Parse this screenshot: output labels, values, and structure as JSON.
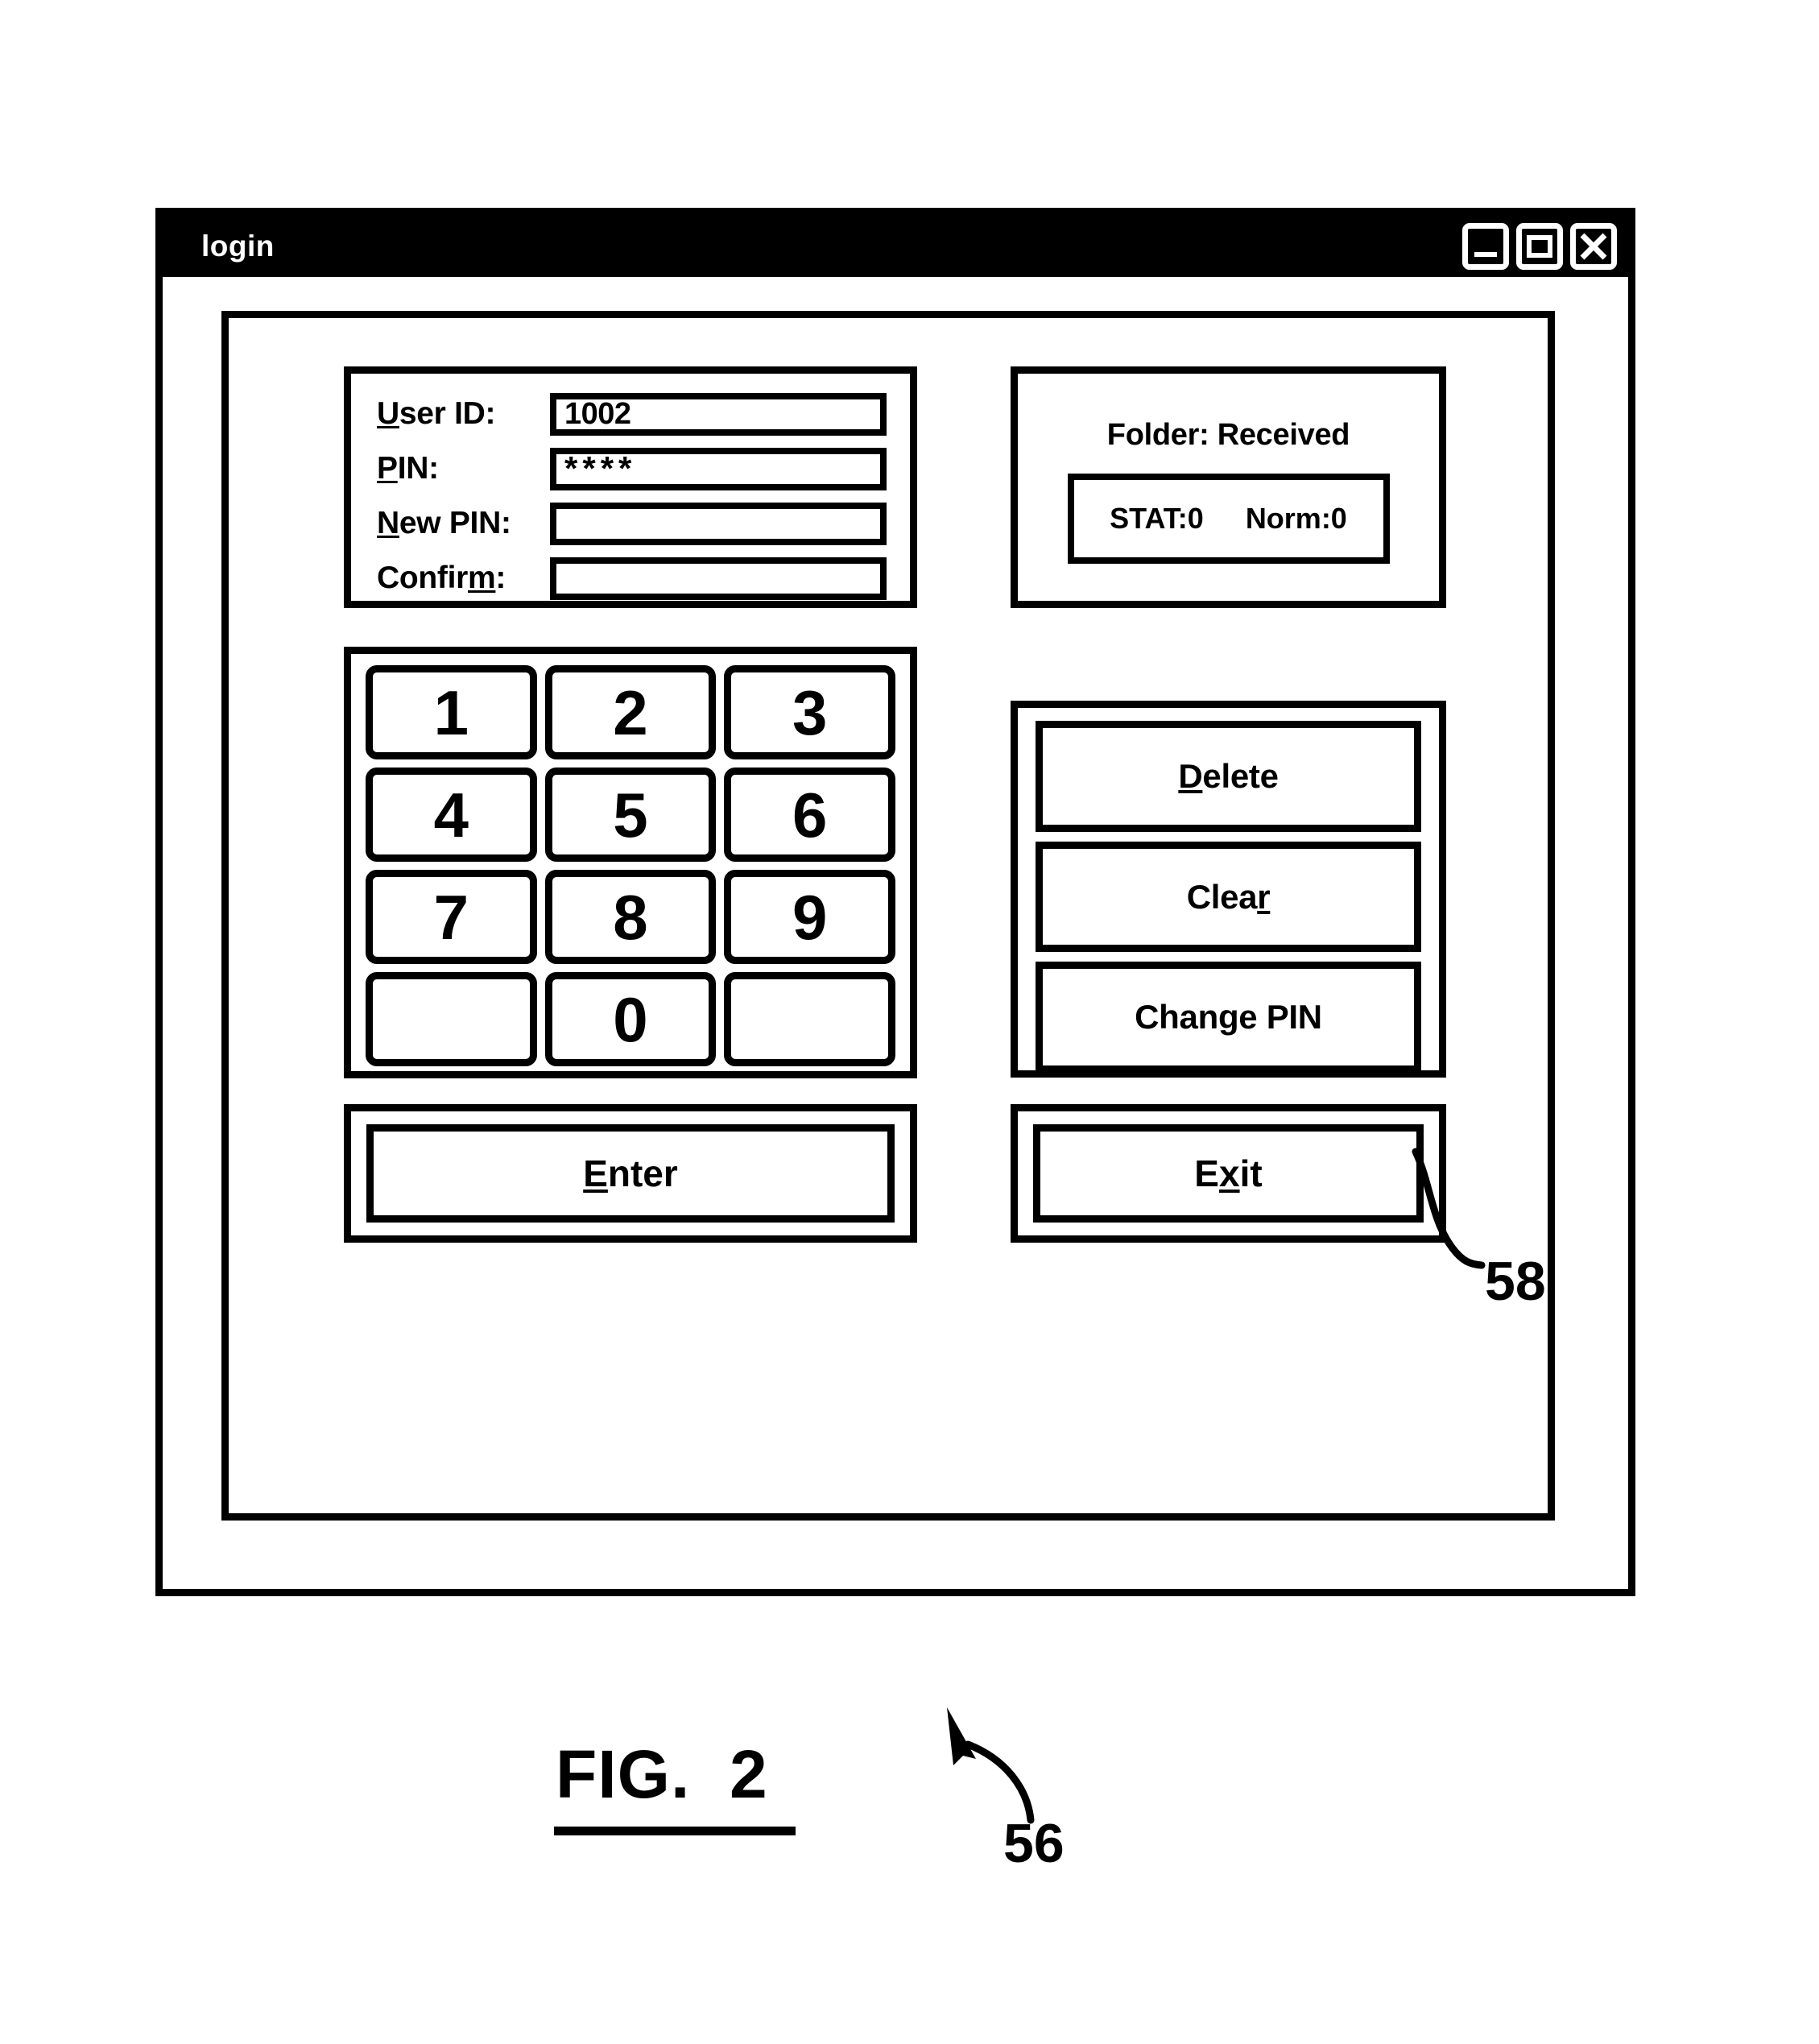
{
  "window": {
    "title": "login",
    "controls": [
      {
        "name": "minimize",
        "icon": "minimize-icon"
      },
      {
        "name": "maximize",
        "icon": "maximize-icon"
      },
      {
        "name": "close",
        "icon": "close-icon"
      }
    ]
  },
  "credentials": {
    "fields": [
      {
        "label_pre": "",
        "label_key": "U",
        "label_post": "ser ID:",
        "value": "1002",
        "masked": false
      },
      {
        "label_pre": "",
        "label_key": "P",
        "label_post": "IN:",
        "value": "****",
        "masked": true
      },
      {
        "label_pre": "",
        "label_key": "N",
        "label_post": "ew PIN:",
        "value": "",
        "masked": false
      },
      {
        "label_pre": "Confir",
        "label_key": "m",
        "label_post": ":",
        "value": "",
        "masked": false
      }
    ]
  },
  "folder": {
    "title": "Folder: Received",
    "stat_label": "STAT:0",
    "norm_label": "Norm:0"
  },
  "keypad": {
    "keys": [
      "1",
      "2",
      "3",
      "4",
      "5",
      "6",
      "7",
      "8",
      "9",
      "",
      "0",
      ""
    ]
  },
  "actions": {
    "buttons": [
      {
        "pre": "",
        "key": "D",
        "post": "elete"
      },
      {
        "pre": "Clea",
        "key": "r",
        "post": ""
      },
      {
        "pre": "Change PIN",
        "key": "",
        "post": ""
      }
    ]
  },
  "bottom": {
    "enter": {
      "pre": "",
      "key": "E",
      "post": "nter"
    },
    "exit": {
      "pre": "E",
      "key": "x",
      "post": "it"
    }
  },
  "annotations": {
    "figure_caption": "FIG.  2",
    "ref_window": "56",
    "ref_change_pin": "58"
  },
  "colors": {
    "ink": "#000000",
    "paper": "#ffffff",
    "titlebar_text": "#ffffff"
  }
}
